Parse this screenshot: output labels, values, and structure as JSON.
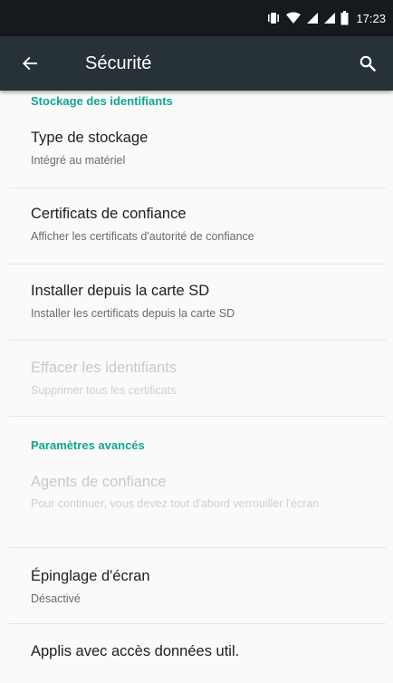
{
  "status_bar": {
    "time": "17:23",
    "icons": [
      "vibrate-icon",
      "wifi-icon",
      "signal-icon",
      "signal-icon",
      "battery-icon"
    ]
  },
  "app_bar": {
    "title": "Sécurité",
    "back_icon": "back-arrow-icon",
    "search_icon": "search-icon"
  },
  "sections": {
    "credentials_header": "Stockage des identifiants",
    "advanced_header": "Paramètres avancés"
  },
  "items": {
    "storage_type": {
      "title": "Type de stockage",
      "summary": "Intégré au matériel",
      "enabled": true
    },
    "trusted_certs": {
      "title": "Certificats de confiance",
      "summary": "Afficher les certificats d'autorité de confiance",
      "enabled": true
    },
    "install_sd": {
      "title": "Installer depuis la carte SD",
      "summary": "Installer les certificats depuis la carte SD",
      "enabled": true
    },
    "clear_credentials": {
      "title": "Effacer les identifiants",
      "summary": "Supprimer tous les certificats",
      "enabled": false
    },
    "trust_agents": {
      "title": "Agents de confiance",
      "summary": "Pour continuer, vous devez tout d'abord verrouiller l'écran",
      "enabled": false
    },
    "screen_pinning": {
      "title": "Épinglage d'écran",
      "summary": "Désactivé",
      "enabled": true
    },
    "usage_access": {
      "title": "Applis avec accès données util.",
      "enabled": true
    }
  },
  "colors": {
    "status_bar": "#161a1c",
    "app_bar": "#263238",
    "accent": "#11a592",
    "background": "#fafafa"
  }
}
